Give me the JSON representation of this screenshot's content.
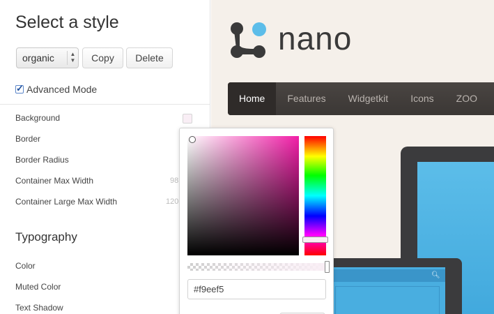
{
  "panel": {
    "title": "Select a style",
    "style_select": {
      "value": "organic"
    },
    "buttons": {
      "copy": "Copy",
      "delete": "Delete"
    },
    "advanced_mode": {
      "label": "Advanced Mode",
      "checked": true
    },
    "properties": [
      {
        "label": "Background",
        "value": ""
      },
      {
        "label": "Border",
        "value": ""
      },
      {
        "label": "Border Radius",
        "value": ""
      },
      {
        "label": "Container Max Width",
        "value": "98"
      },
      {
        "label": "Container Large Max Width",
        "value": "120"
      }
    ],
    "section_title": "Typography",
    "typography": [
      {
        "label": "Color"
      },
      {
        "label": "Muted Color"
      },
      {
        "label": "Text Shadow"
      }
    ],
    "background_swatch_color": "#f9eef5"
  },
  "color_picker": {
    "hex_value": "#f9eef5",
    "hue_color": "#f21fa8"
  },
  "preview": {
    "logo_text": "nano",
    "nav": [
      {
        "label": "Home",
        "active": true
      },
      {
        "label": "Features",
        "active": false
      },
      {
        "label": "Widgetkit",
        "active": false
      },
      {
        "label": "Icons",
        "active": false
      },
      {
        "label": "ZOO",
        "active": false
      }
    ],
    "background_color": "#f5f0ea",
    "navbar_color": "#3b3735",
    "accent_blue": "#5cbde9"
  }
}
